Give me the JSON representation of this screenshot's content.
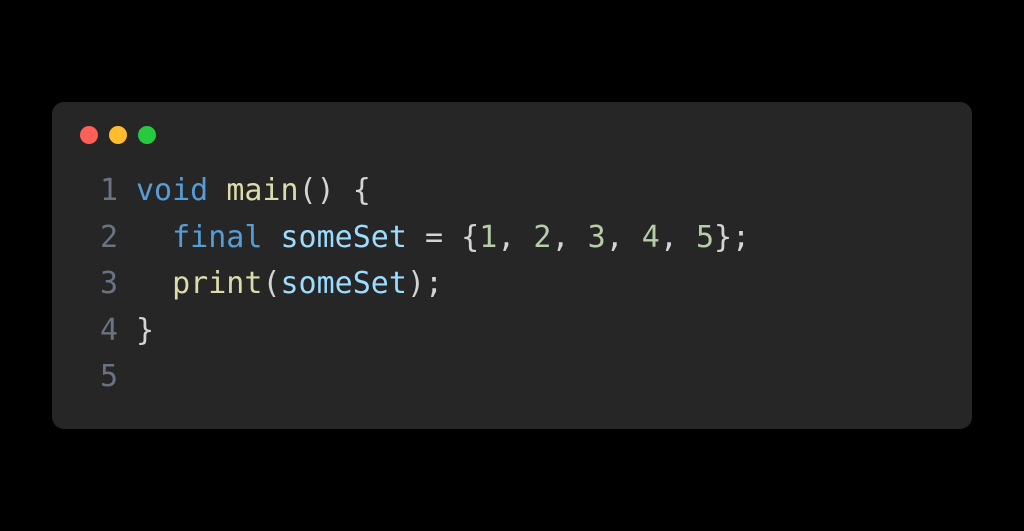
{
  "window": {
    "controls": {
      "close_color": "#ff5f56",
      "minimize_color": "#ffbd2e",
      "maximize_color": "#27c93f"
    }
  },
  "code": {
    "language": "dart",
    "lines": [
      {
        "number": "1",
        "tokens": [
          {
            "type": "keyword",
            "text": "void"
          },
          {
            "type": "space",
            "text": " "
          },
          {
            "type": "func",
            "text": "main"
          },
          {
            "type": "punct",
            "text": "() {"
          }
        ]
      },
      {
        "number": "2",
        "tokens": [
          {
            "type": "space",
            "text": "  "
          },
          {
            "type": "keyword",
            "text": "final"
          },
          {
            "type": "space",
            "text": " "
          },
          {
            "type": "ident",
            "text": "someSet"
          },
          {
            "type": "space",
            "text": " "
          },
          {
            "type": "punct",
            "text": "="
          },
          {
            "type": "space",
            "text": " "
          },
          {
            "type": "punct",
            "text": "{"
          },
          {
            "type": "number",
            "text": "1"
          },
          {
            "type": "punct",
            "text": ", "
          },
          {
            "type": "number",
            "text": "2"
          },
          {
            "type": "punct",
            "text": ", "
          },
          {
            "type": "number",
            "text": "3"
          },
          {
            "type": "punct",
            "text": ", "
          },
          {
            "type": "number",
            "text": "4"
          },
          {
            "type": "punct",
            "text": ", "
          },
          {
            "type": "number",
            "text": "5"
          },
          {
            "type": "punct",
            "text": "};"
          }
        ]
      },
      {
        "number": "3",
        "tokens": [
          {
            "type": "space",
            "text": "  "
          },
          {
            "type": "func",
            "text": "print"
          },
          {
            "type": "punct",
            "text": "("
          },
          {
            "type": "ident",
            "text": "someSet"
          },
          {
            "type": "punct",
            "text": ");"
          }
        ]
      },
      {
        "number": "4",
        "tokens": [
          {
            "type": "punct",
            "text": "}"
          }
        ]
      },
      {
        "number": "5",
        "tokens": []
      }
    ]
  }
}
